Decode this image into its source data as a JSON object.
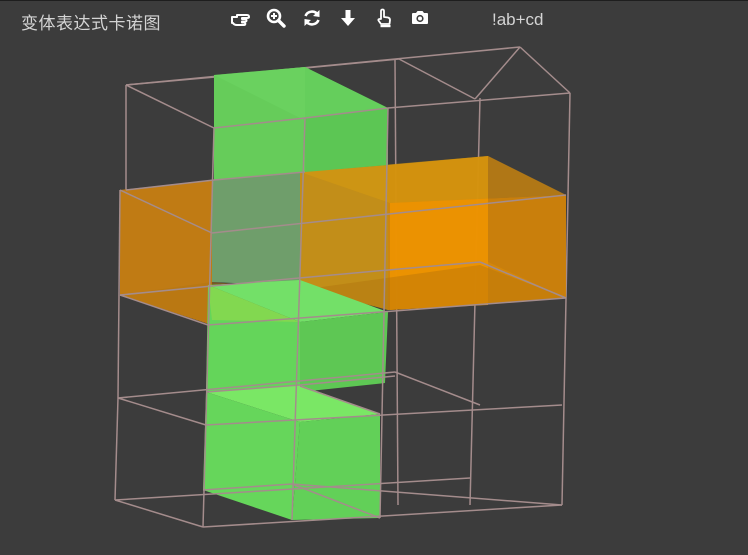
{
  "app": {
    "title": "变体表达式卡诺图"
  },
  "toolbar": {
    "tools": [
      {
        "name": "pointer-icon"
      },
      {
        "name": "zoom-icon"
      },
      {
        "name": "reset-icon"
      },
      {
        "name": "download-icon"
      },
      {
        "name": "select-hand-icon"
      },
      {
        "name": "camera-icon"
      }
    ],
    "expression": "!ab+cd"
  },
  "colors": {
    "background": "#3c3c3c",
    "text": "#d4d4d4",
    "grid_line": "#a48c8c",
    "green": "#6fe05a",
    "orange": "#f09400",
    "overlap": "#7a9f6a"
  }
}
